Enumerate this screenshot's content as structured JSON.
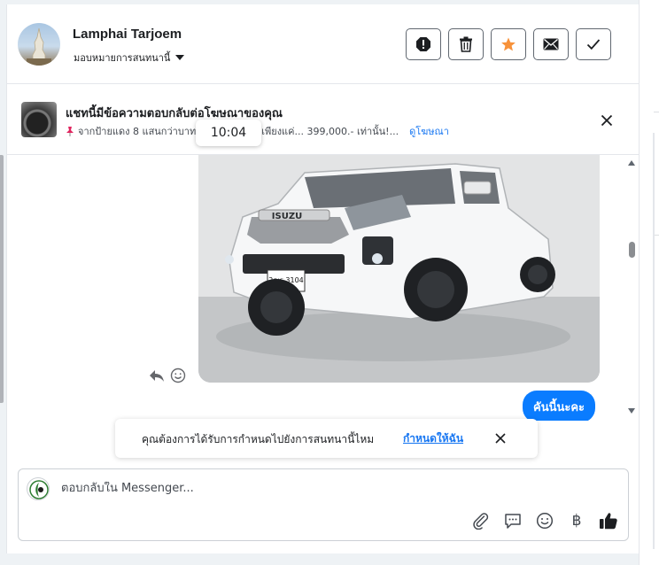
{
  "header": {
    "name": "Lamphai Tarjoem",
    "assign_label": "มอบหมายการสนทนานี้",
    "actions": [
      "report-icon",
      "trash-icon",
      "star-icon",
      "envelope-icon",
      "check-icon"
    ],
    "star_color": "#f7923a"
  },
  "ad": {
    "title": "แชทนี้มีข้อความตอบกลับต่อโฆษณาของคุณ",
    "subtitle": "จากป้ายแดง 8 แสนกว่าบาท",
    "subtitle_rest": "เพียงแค่... 399,000.- เท่านั้น!...",
    "link": "ดูโฆษณา",
    "tooltip_time": "10:04"
  },
  "chat": {
    "plate": "2ฒร 3104",
    "brand": "ISUZU",
    "bubble_text": "คันนี้นะคะ",
    "bubble_color": "#0a7cff"
  },
  "suggestion": {
    "text": "คุณต้องการได้รับการกำหนดไปยังการสนทนานี้ไหม",
    "link": "กำหนดให้ฉัน"
  },
  "reply": {
    "placeholder": "ตอบกลับใน Messenger...",
    "tools": [
      "paperclip-icon",
      "saved-reply-icon",
      "emoji-icon",
      "baht-icon",
      "thumbs-up-icon"
    ],
    "baht_symbol": "฿"
  }
}
